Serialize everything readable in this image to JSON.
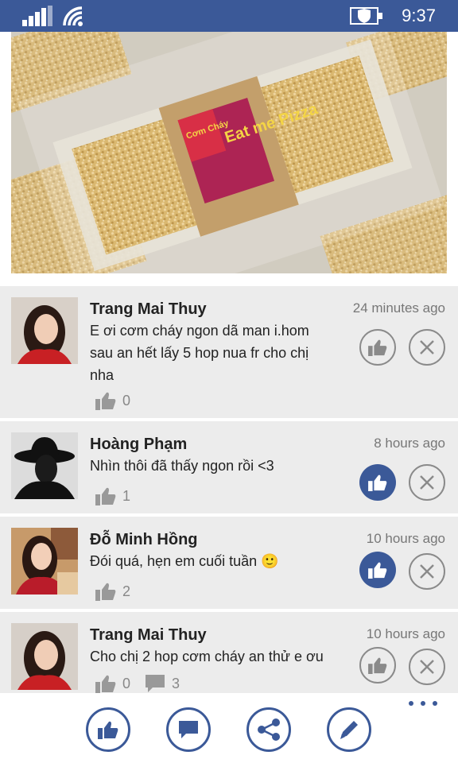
{
  "status_bar": {
    "time": "9:37"
  },
  "comments": [
    {
      "name": "Trang Mai Thuy",
      "time": "24 minutes ago",
      "text_lines": [
        "E ơi cơm cháy ngon dã man i.hom",
        "sau an hết lấy 5 hop nua fr cho chị",
        "nha"
      ],
      "likes": "0",
      "replies": "",
      "liked": false
    },
    {
      "name": "Hoàng Phạm",
      "time": "8 hours ago",
      "text_lines": [
        "Nhìn thôi đã thấy ngon rồi <3"
      ],
      "likes": "1",
      "replies": "",
      "liked": true
    },
    {
      "name": "Đỗ Minh Hồng",
      "time": "10 hours ago",
      "text_lines": [
        "Đói quá, hẹn em cuối tuần 🙂"
      ],
      "likes": "2",
      "replies": "",
      "liked": true
    },
    {
      "name": "Trang Mai Thuy",
      "time": "10 hours ago",
      "text_lines": [
        "Cho chị 2 hop cơm cháy an thử e ơu"
      ],
      "likes": "0",
      "replies": "3",
      "liked": false
    }
  ],
  "photo": {
    "packaging_label": "Eat me Pizza",
    "brand": "Cơm Cháy"
  },
  "colors": {
    "brand": "#3b5998",
    "card_bg": "#ececec",
    "muted": "#888888"
  },
  "icons": {
    "status": [
      "signal-icon",
      "wifi-icon",
      "battery-icon"
    ],
    "app_bar": [
      "like-icon",
      "comment-icon",
      "share-icon",
      "edit-icon",
      "more-icon"
    ]
  }
}
